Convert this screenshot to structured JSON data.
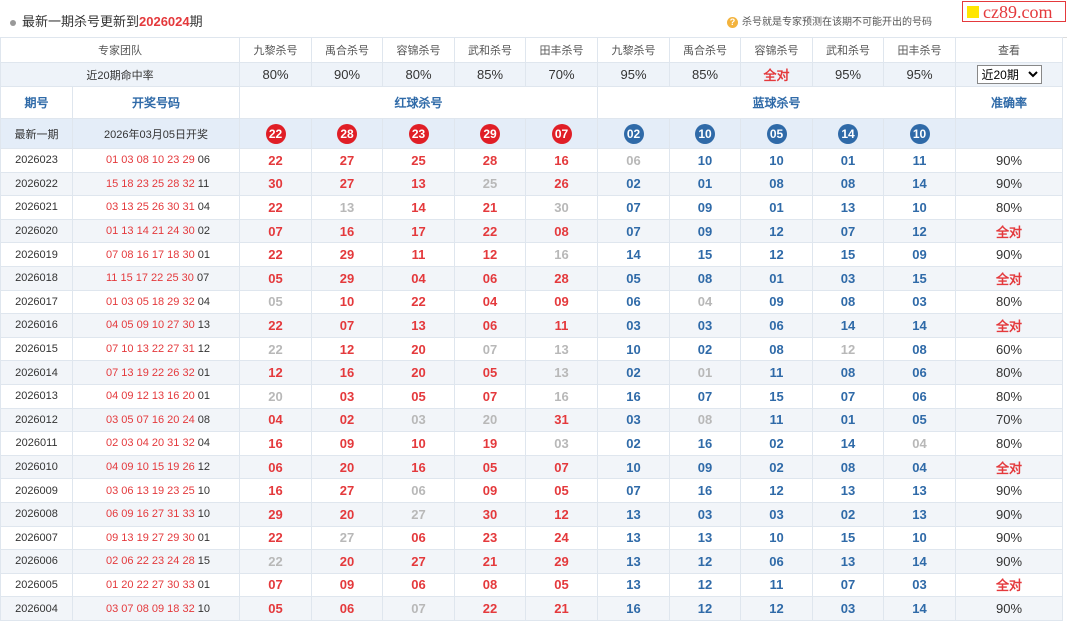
{
  "header": {
    "title_prefix": "最新一期杀号更新到",
    "title_issue": "2026024",
    "title_suffix": "期",
    "tip_icon": "question-icon",
    "tip": "杀号就是专家预测在该期不可能开出的号码",
    "logo": "cz89.com"
  },
  "table": {
    "team_label": "专家团队",
    "experts": [
      "九黎杀号",
      "禹合杀号",
      "容锦杀号",
      "武和杀号",
      "田丰杀号",
      "九黎杀号",
      "禹合杀号",
      "容锦杀号",
      "武和杀号",
      "田丰杀号"
    ],
    "view_label": "查看",
    "rate_label": "近20期命中率",
    "rates": [
      "80%",
      "90%",
      "80%",
      "85%",
      "70%",
      "95%",
      "85%",
      "全对",
      "95%",
      "95%"
    ],
    "range_select": "近20期",
    "col_issue": "期号",
    "col_draw": "开奖号码",
    "col_red": "红球杀号",
    "col_blue": "蓝球杀号",
    "col_acc": "准确率",
    "latest_label": "最新一期",
    "latest_date": "2026年03月05日开奖",
    "latest_red": [
      "22",
      "28",
      "23",
      "29",
      "07"
    ],
    "latest_blue": [
      "02",
      "10",
      "05",
      "14",
      "10"
    ],
    "rows": [
      {
        "issue": "2026023",
        "red": "01 03 08 10 23 29",
        "blue": "06",
        "kills": [
          "22",
          "27",
          "25",
          "28",
          "16",
          "06",
          "10",
          "10",
          "01",
          "11"
        ],
        "fail": [
          false,
          false,
          false,
          false,
          false,
          true,
          false,
          false,
          false,
          false
        ],
        "acc": "90%"
      },
      {
        "issue": "2026022",
        "red": "15 18 23 25 28 32",
        "blue": "11",
        "kills": [
          "30",
          "27",
          "13",
          "25",
          "26",
          "02",
          "01",
          "08",
          "08",
          "14"
        ],
        "fail": [
          false,
          false,
          false,
          true,
          false,
          false,
          false,
          false,
          false,
          false
        ],
        "acc": "90%"
      },
      {
        "issue": "2026021",
        "red": "03 13 25 26 30 31",
        "blue": "04",
        "kills": [
          "22",
          "13",
          "14",
          "21",
          "30",
          "07",
          "09",
          "01",
          "13",
          "10"
        ],
        "fail": [
          false,
          true,
          false,
          false,
          true,
          false,
          false,
          false,
          false,
          false
        ],
        "acc": "80%"
      },
      {
        "issue": "2026020",
        "red": "01 13 14 21 24 30",
        "blue": "02",
        "kills": [
          "07",
          "16",
          "17",
          "22",
          "08",
          "07",
          "09",
          "12",
          "07",
          "12"
        ],
        "fail": [
          false,
          false,
          false,
          false,
          false,
          false,
          false,
          false,
          false,
          false
        ],
        "acc": "全对"
      },
      {
        "issue": "2026019",
        "red": "07 08 16 17 18 30",
        "blue": "01",
        "kills": [
          "22",
          "29",
          "11",
          "12",
          "16",
          "14",
          "15",
          "12",
          "15",
          "09"
        ],
        "fail": [
          false,
          false,
          false,
          false,
          true,
          false,
          false,
          false,
          false,
          false
        ],
        "acc": "90%"
      },
      {
        "issue": "2026018",
        "red": "11 15 17 22 25 30",
        "blue": "07",
        "kills": [
          "05",
          "29",
          "04",
          "06",
          "28",
          "05",
          "08",
          "01",
          "03",
          "15"
        ],
        "fail": [
          false,
          false,
          false,
          false,
          false,
          false,
          false,
          false,
          false,
          false
        ],
        "acc": "全对"
      },
      {
        "issue": "2026017",
        "red": "01 03 05 18 29 32",
        "blue": "04",
        "kills": [
          "05",
          "10",
          "22",
          "04",
          "09",
          "06",
          "04",
          "09",
          "08",
          "03"
        ],
        "fail": [
          true,
          false,
          false,
          false,
          false,
          false,
          true,
          false,
          false,
          false
        ],
        "acc": "80%"
      },
      {
        "issue": "2026016",
        "red": "04 05 09 10 27 30",
        "blue": "13",
        "kills": [
          "22",
          "07",
          "13",
          "06",
          "11",
          "03",
          "03",
          "06",
          "14",
          "14"
        ],
        "fail": [
          false,
          false,
          false,
          false,
          false,
          false,
          false,
          false,
          false,
          false
        ],
        "acc": "全对"
      },
      {
        "issue": "2026015",
        "red": "07 10 13 22 27 31",
        "blue": "12",
        "kills": [
          "22",
          "12",
          "20",
          "07",
          "13",
          "10",
          "02",
          "08",
          "12",
          "08"
        ],
        "fail": [
          true,
          false,
          false,
          true,
          true,
          false,
          false,
          false,
          true,
          false
        ],
        "acc": "60%"
      },
      {
        "issue": "2026014",
        "red": "07 13 19 22 26 32",
        "blue": "01",
        "kills": [
          "12",
          "16",
          "20",
          "05",
          "13",
          "02",
          "01",
          "11",
          "08",
          "06"
        ],
        "fail": [
          false,
          false,
          false,
          false,
          true,
          false,
          true,
          false,
          false,
          false
        ],
        "acc": "80%"
      },
      {
        "issue": "2026013",
        "red": "04 09 12 13 16 20",
        "blue": "01",
        "kills": [
          "20",
          "03",
          "05",
          "07",
          "16",
          "16",
          "07",
          "15",
          "07",
          "06"
        ],
        "fail": [
          true,
          false,
          false,
          false,
          true,
          false,
          false,
          false,
          false,
          false
        ],
        "acc": "80%"
      },
      {
        "issue": "2026012",
        "red": "03 05 07 16 20 24",
        "blue": "08",
        "kills": [
          "04",
          "02",
          "03",
          "20",
          "31",
          "03",
          "08",
          "11",
          "01",
          "05"
        ],
        "fail": [
          false,
          false,
          true,
          true,
          false,
          false,
          true,
          false,
          false,
          false
        ],
        "acc": "70%"
      },
      {
        "issue": "2026011",
        "red": "02 03 04 20 31 32",
        "blue": "04",
        "kills": [
          "16",
          "09",
          "10",
          "19",
          "03",
          "02",
          "16",
          "02",
          "14",
          "04"
        ],
        "fail": [
          false,
          false,
          false,
          false,
          true,
          false,
          false,
          false,
          false,
          true
        ],
        "acc": "80%"
      },
      {
        "issue": "2026010",
        "red": "04 09 10 15 19 26",
        "blue": "12",
        "kills": [
          "06",
          "20",
          "16",
          "05",
          "07",
          "10",
          "09",
          "02",
          "08",
          "04"
        ],
        "fail": [
          false,
          false,
          false,
          false,
          false,
          false,
          false,
          false,
          false,
          false
        ],
        "acc": "全对"
      },
      {
        "issue": "2026009",
        "red": "03 06 13 19 23 25",
        "blue": "10",
        "kills": [
          "16",
          "27",
          "06",
          "09",
          "05",
          "07",
          "16",
          "12",
          "13",
          "13"
        ],
        "fail": [
          false,
          false,
          true,
          false,
          false,
          false,
          false,
          false,
          false,
          false
        ],
        "acc": "90%"
      },
      {
        "issue": "2026008",
        "red": "06 09 16 27 31 33",
        "blue": "10",
        "kills": [
          "29",
          "20",
          "27",
          "30",
          "12",
          "13",
          "03",
          "03",
          "02",
          "13"
        ],
        "fail": [
          false,
          false,
          true,
          false,
          false,
          false,
          false,
          false,
          false,
          false
        ],
        "acc": "90%"
      },
      {
        "issue": "2026007",
        "red": "09 13 19 27 29 30",
        "blue": "01",
        "kills": [
          "22",
          "27",
          "06",
          "23",
          "24",
          "13",
          "13",
          "10",
          "15",
          "10"
        ],
        "fail": [
          false,
          true,
          false,
          false,
          false,
          false,
          false,
          false,
          false,
          false
        ],
        "acc": "90%"
      },
      {
        "issue": "2026006",
        "red": "02 06 22 23 24 28",
        "blue": "15",
        "kills": [
          "22",
          "20",
          "27",
          "21",
          "29",
          "13",
          "12",
          "06",
          "13",
          "14"
        ],
        "fail": [
          true,
          false,
          false,
          false,
          false,
          false,
          false,
          false,
          false,
          false
        ],
        "acc": "90%"
      },
      {
        "issue": "2026005",
        "red": "01 20 22 27 30 33",
        "blue": "01",
        "kills": [
          "07",
          "09",
          "06",
          "08",
          "05",
          "13",
          "12",
          "11",
          "07",
          "03"
        ],
        "fail": [
          false,
          false,
          false,
          false,
          false,
          false,
          false,
          false,
          false,
          false
        ],
        "acc": "全对"
      },
      {
        "issue": "2026004",
        "red": "03 07 08 09 18 32",
        "blue": "10",
        "kills": [
          "05",
          "06",
          "07",
          "22",
          "21",
          "16",
          "12",
          "12",
          "03",
          "14"
        ],
        "fail": [
          false,
          false,
          true,
          false,
          false,
          false,
          false,
          false,
          false,
          false
        ],
        "acc": "90%"
      }
    ]
  }
}
